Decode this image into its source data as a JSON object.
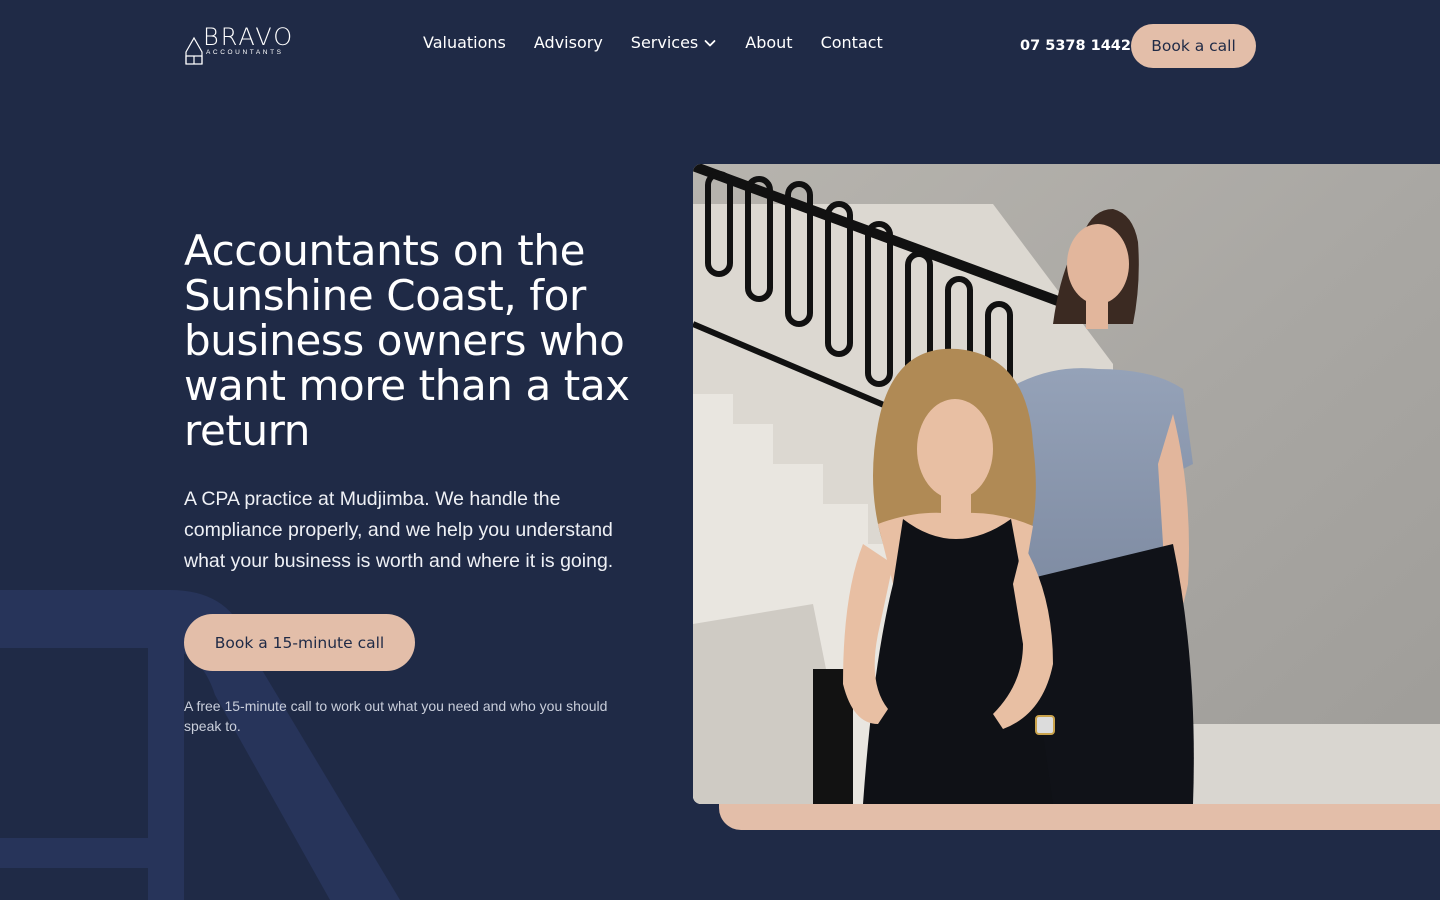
{
  "brand": {
    "name": "BRAVO",
    "tagline": "ACCOUNTANTS",
    "logo_icon": "house-icon"
  },
  "nav": {
    "items": [
      {
        "label": "Valuations"
      },
      {
        "label": "Advisory"
      },
      {
        "label": "Services",
        "icon": "chevron-down-icon"
      },
      {
        "label": "About"
      },
      {
        "label": "Contact"
      }
    ]
  },
  "header": {
    "phone": "07 5378 1442",
    "cta_label": "Book a call"
  },
  "hero": {
    "title": "Accountants on the Sunshine Coast, for business owners who want more than a tax return",
    "lead": "A CPA practice at Mudjimba. We handle the compliance properly, and we help you understand what your business is worth and where it is going.",
    "cta_label": "Book a 15-minute call",
    "note": "A free 15-minute call to work out what you need and who you should speak to."
  },
  "colors": {
    "background": "#1f2a46",
    "accent": "#e3bea9",
    "text": "#ffffff"
  }
}
